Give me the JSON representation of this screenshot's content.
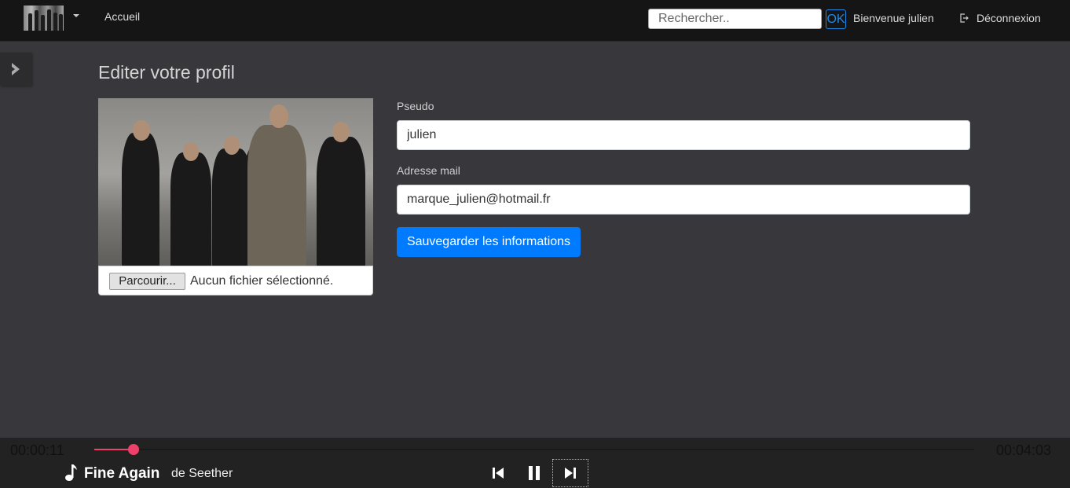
{
  "navbar": {
    "home_label": "Accueil",
    "search_placeholder": "Rechercher..",
    "search_button_label": "OK",
    "welcome_text": "Bienvenue julien",
    "logout_label": "Déconnexion"
  },
  "profile": {
    "title": "Editer votre profil",
    "file_button_label": "Parcourir...",
    "file_status": "Aucun fichier sélectionné.",
    "pseudo_label": "Pseudo",
    "pseudo_value": "julien",
    "email_label": "Adresse mail",
    "email_value": "marque_julien@hotmail.fr",
    "save_label": "Sauvegarder les informations"
  },
  "player": {
    "elapsed": "00:00:11",
    "total": "00:04:03",
    "progress_fraction": 0.045,
    "track_title": "Fine Again",
    "track_artist": "de Seether",
    "accent_color": "#ef3f6b"
  },
  "colors": {
    "navbar_bg": "#151515",
    "page_bg": "#38383c",
    "primary": "#007bff"
  }
}
